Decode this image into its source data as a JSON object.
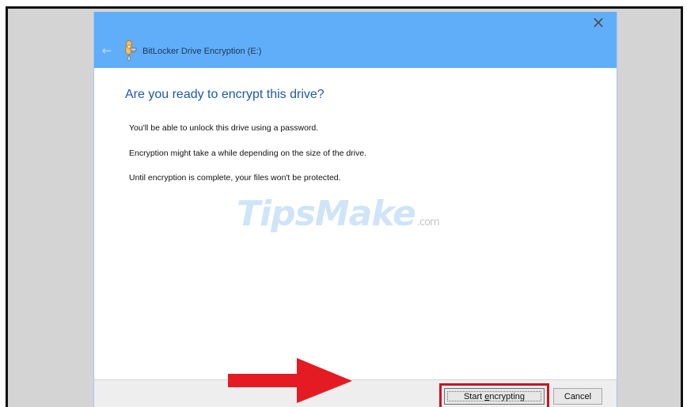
{
  "window": {
    "title": "BitLocker Drive Encryption (E:)",
    "close_symbol": "×",
    "back_symbol": "←"
  },
  "content": {
    "heading": "Are you ready to encrypt this drive?",
    "lines": [
      "You'll be able to unlock this drive using a password.",
      "Encryption might take a while depending on the size of the drive.",
      "Until encryption is complete, your files won't be protected."
    ]
  },
  "watermark": {
    "main": "TipsMake",
    "suffix": ".com"
  },
  "footer": {
    "start_label_prefix": "Start ",
    "start_label_accel": "e",
    "start_label_suffix": "ncrypting",
    "cancel_label": "Cancel"
  },
  "colors": {
    "titlebar": "#60aef9",
    "heading": "#1c59a8",
    "highlight": "#c8151f",
    "arrow": "#e41b22"
  },
  "icons": {
    "back": "back-arrow-icon",
    "close": "close-icon",
    "bitlocker": "bitlocker-key-icon",
    "pointer": "red-arrow-icon"
  }
}
